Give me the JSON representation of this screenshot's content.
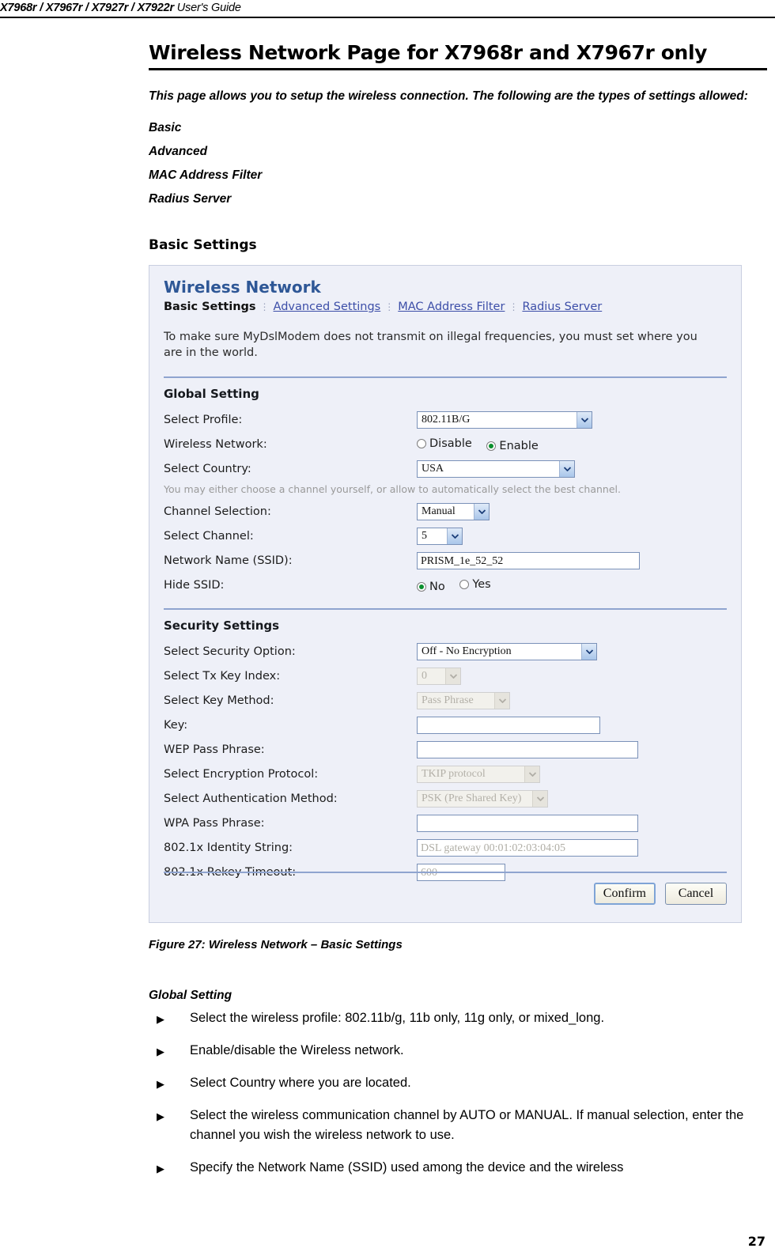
{
  "document": {
    "running_header": {
      "models": "X7968r / X7967r / X7927r / X7922r",
      "suffix": " User's Guide"
    },
    "page_number": "27",
    "title": "Wireless Network Page for X7968r and X7967r only",
    "intro": "This page allows you to setup the wireless connection. The following are the types of settings allowed:",
    "settings_types": [
      "Basic",
      "Advanced",
      "MAC Address Filter",
      "Radius Server"
    ],
    "section_heading": "Basic Settings",
    "figure_caption": "Figure 27: Wireless Network – Basic Settings",
    "subsection_heading": "Global Setting",
    "bullets": [
      "Select the wireless profile: 802.11b/g, 11b only, 11g only, or mixed_long.",
      "Enable/disable the Wireless network.",
      "Select Country where you are located.",
      "Select the wireless communication channel by AUTO or MANUAL. If manual selection, enter the channel you wish the wireless network to use.",
      "Specify the Network Name (SSID) used among the device and the wireless"
    ],
    "bullet_marker": "▶"
  },
  "screenshot": {
    "title": "Wireless Network",
    "tabs": [
      {
        "label": "Basic Settings",
        "active": true
      },
      {
        "label": "Advanced Settings",
        "active": false
      },
      {
        "label": "MAC Address Filter",
        "active": false
      },
      {
        "label": "Radius Server",
        "active": false
      }
    ],
    "tab_separator": "⋮",
    "description": "To make sure MyDslModem does not transmit on illegal frequencies, you must set where you are in the world.",
    "global_setting": {
      "title": "Global Setting",
      "channel_hint": "You may either choose a channel yourself, or allow to automatically select the best channel.",
      "fields": {
        "select_profile": {
          "label": "Select Profile:",
          "value": "802.11B/G"
        },
        "wireless_network": {
          "label": "Wireless Network:",
          "options": [
            "Disable",
            "Enable"
          ],
          "selected": "Enable"
        },
        "select_country": {
          "label": "Select Country:",
          "value": "USA"
        },
        "channel_selection": {
          "label": "Channel Selection:",
          "value": "Manual"
        },
        "select_channel": {
          "label": "Select Channel:",
          "value": "5"
        },
        "network_name": {
          "label": "Network Name (SSID):",
          "value": "PRISM_1e_52_52"
        },
        "hide_ssid": {
          "label": "Hide SSID:",
          "options": [
            "No",
            "Yes"
          ],
          "selected": "No"
        }
      }
    },
    "security_settings": {
      "title": "Security Settings",
      "fields": {
        "security_option": {
          "label": "Select Security Option:",
          "value": "Off - No Encryption",
          "disabled": false
        },
        "tx_key_index": {
          "label": "Select Tx Key Index:",
          "value": "0",
          "disabled": true
        },
        "key_method": {
          "label": "Select Key Method:",
          "value": "Pass Phrase",
          "disabled": true
        },
        "key": {
          "label": "Key:",
          "value": "",
          "disabled": false
        },
        "wep_pass_phrase": {
          "label": "WEP Pass Phrase:",
          "value": "",
          "disabled": false
        },
        "encryption_protocol": {
          "label": "Select Encryption Protocol:",
          "value": "TKIP protocol",
          "disabled": true
        },
        "authentication_method": {
          "label": "Select Authentication Method:",
          "value": "PSK (Pre Shared Key)",
          "disabled": true
        },
        "wpa_pass_phrase": {
          "label": "WPA Pass Phrase:",
          "value": "",
          "disabled": false
        },
        "identity_string": {
          "label": "802.1x Identity String:",
          "value": "DSL gateway 00:01:02:03:04:05",
          "disabled": true
        },
        "rekey_timeout": {
          "label": "802.1x Rekey Timeout:",
          "value": "600",
          "disabled": true
        }
      }
    },
    "buttons": {
      "confirm": "Confirm",
      "cancel": "Cancel"
    },
    "colors": {
      "panel_bg": "#eef0f8",
      "title_blue": "#2e5796",
      "link_blue": "#3c4ea8",
      "rule_blue": "#8fa4cf",
      "radio_green": "#0a8f2e"
    }
  }
}
